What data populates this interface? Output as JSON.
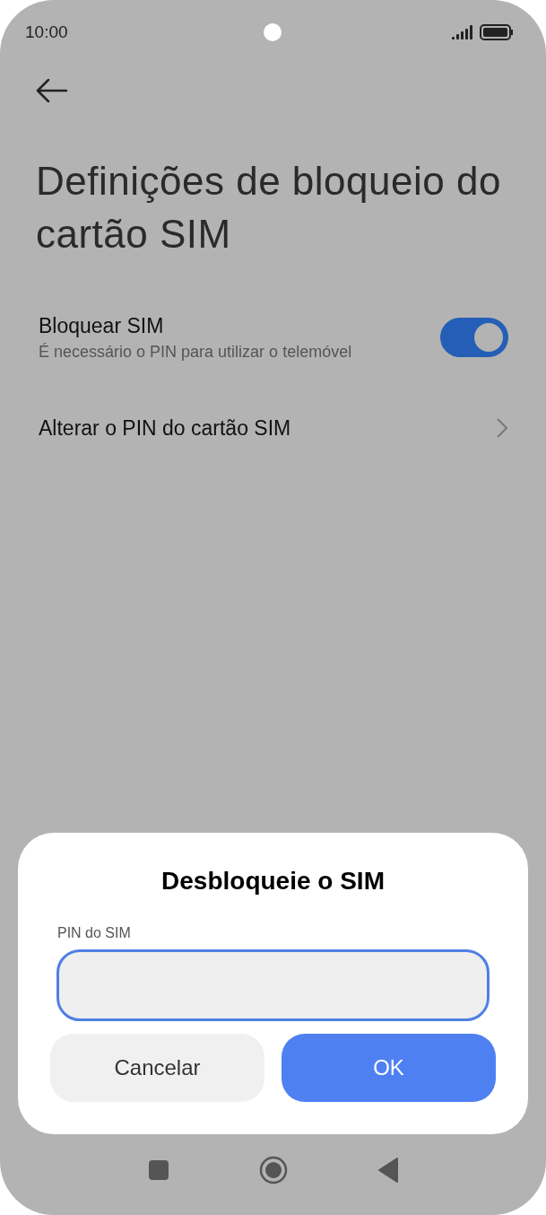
{
  "status_bar": {
    "time": "10:00"
  },
  "title": "Definições de bloqueio do cartão SIM",
  "settings": [
    {
      "kind": "toggle",
      "label": "Bloquear SIM",
      "subtitle": "É necessário o PIN para utilizar o telemóvel",
      "on": true
    },
    {
      "kind": "link",
      "label": "Alterar o PIN do cartão SIM"
    }
  ],
  "dialog": {
    "title": "Desbloqueie o SIM",
    "field_label": "PIN do SIM",
    "focused": true,
    "buttons": [
      {
        "kind": "secondary",
        "label": "Cancelar"
      },
      {
        "kind": "primary",
        "label": "OK"
      }
    ]
  }
}
